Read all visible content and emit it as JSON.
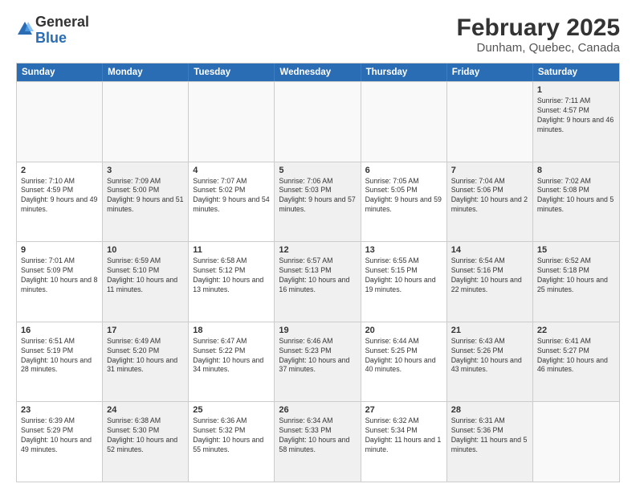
{
  "logo": {
    "general": "General",
    "blue": "Blue"
  },
  "title": "February 2025",
  "subtitle": "Dunham, Quebec, Canada",
  "headers": [
    "Sunday",
    "Monday",
    "Tuesday",
    "Wednesday",
    "Thursday",
    "Friday",
    "Saturday"
  ],
  "rows": [
    [
      {
        "day": "",
        "info": "",
        "empty": true
      },
      {
        "day": "",
        "info": "",
        "empty": true
      },
      {
        "day": "",
        "info": "",
        "empty": true
      },
      {
        "day": "",
        "info": "",
        "empty": true
      },
      {
        "day": "",
        "info": "",
        "empty": true
      },
      {
        "day": "",
        "info": "",
        "empty": true
      },
      {
        "day": "1",
        "info": "Sunrise: 7:11 AM\nSunset: 4:57 PM\nDaylight: 9 hours and 46 minutes.",
        "shaded": true
      }
    ],
    [
      {
        "day": "2",
        "info": "Sunrise: 7:10 AM\nSunset: 4:59 PM\nDaylight: 9 hours and 49 minutes."
      },
      {
        "day": "3",
        "info": "Sunrise: 7:09 AM\nSunset: 5:00 PM\nDaylight: 9 hours and 51 minutes.",
        "shaded": true
      },
      {
        "day": "4",
        "info": "Sunrise: 7:07 AM\nSunset: 5:02 PM\nDaylight: 9 hours and 54 minutes."
      },
      {
        "day": "5",
        "info": "Sunrise: 7:06 AM\nSunset: 5:03 PM\nDaylight: 9 hours and 57 minutes.",
        "shaded": true
      },
      {
        "day": "6",
        "info": "Sunrise: 7:05 AM\nSunset: 5:05 PM\nDaylight: 9 hours and 59 minutes."
      },
      {
        "day": "7",
        "info": "Sunrise: 7:04 AM\nSunset: 5:06 PM\nDaylight: 10 hours and 2 minutes.",
        "shaded": true
      },
      {
        "day": "8",
        "info": "Sunrise: 7:02 AM\nSunset: 5:08 PM\nDaylight: 10 hours and 5 minutes.",
        "shaded": true
      }
    ],
    [
      {
        "day": "9",
        "info": "Sunrise: 7:01 AM\nSunset: 5:09 PM\nDaylight: 10 hours and 8 minutes."
      },
      {
        "day": "10",
        "info": "Sunrise: 6:59 AM\nSunset: 5:10 PM\nDaylight: 10 hours and 11 minutes.",
        "shaded": true
      },
      {
        "day": "11",
        "info": "Sunrise: 6:58 AM\nSunset: 5:12 PM\nDaylight: 10 hours and 13 minutes."
      },
      {
        "day": "12",
        "info": "Sunrise: 6:57 AM\nSunset: 5:13 PM\nDaylight: 10 hours and 16 minutes.",
        "shaded": true
      },
      {
        "day": "13",
        "info": "Sunrise: 6:55 AM\nSunset: 5:15 PM\nDaylight: 10 hours and 19 minutes."
      },
      {
        "day": "14",
        "info": "Sunrise: 6:54 AM\nSunset: 5:16 PM\nDaylight: 10 hours and 22 minutes.",
        "shaded": true
      },
      {
        "day": "15",
        "info": "Sunrise: 6:52 AM\nSunset: 5:18 PM\nDaylight: 10 hours and 25 minutes.",
        "shaded": true
      }
    ],
    [
      {
        "day": "16",
        "info": "Sunrise: 6:51 AM\nSunset: 5:19 PM\nDaylight: 10 hours and 28 minutes."
      },
      {
        "day": "17",
        "info": "Sunrise: 6:49 AM\nSunset: 5:20 PM\nDaylight: 10 hours and 31 minutes.",
        "shaded": true
      },
      {
        "day": "18",
        "info": "Sunrise: 6:47 AM\nSunset: 5:22 PM\nDaylight: 10 hours and 34 minutes."
      },
      {
        "day": "19",
        "info": "Sunrise: 6:46 AM\nSunset: 5:23 PM\nDaylight: 10 hours and 37 minutes.",
        "shaded": true
      },
      {
        "day": "20",
        "info": "Sunrise: 6:44 AM\nSunset: 5:25 PM\nDaylight: 10 hours and 40 minutes."
      },
      {
        "day": "21",
        "info": "Sunrise: 6:43 AM\nSunset: 5:26 PM\nDaylight: 10 hours and 43 minutes.",
        "shaded": true
      },
      {
        "day": "22",
        "info": "Sunrise: 6:41 AM\nSunset: 5:27 PM\nDaylight: 10 hours and 46 minutes.",
        "shaded": true
      }
    ],
    [
      {
        "day": "23",
        "info": "Sunrise: 6:39 AM\nSunset: 5:29 PM\nDaylight: 10 hours and 49 minutes."
      },
      {
        "day": "24",
        "info": "Sunrise: 6:38 AM\nSunset: 5:30 PM\nDaylight: 10 hours and 52 minutes.",
        "shaded": true
      },
      {
        "day": "25",
        "info": "Sunrise: 6:36 AM\nSunset: 5:32 PM\nDaylight: 10 hours and 55 minutes."
      },
      {
        "day": "26",
        "info": "Sunrise: 6:34 AM\nSunset: 5:33 PM\nDaylight: 10 hours and 58 minutes.",
        "shaded": true
      },
      {
        "day": "27",
        "info": "Sunrise: 6:32 AM\nSunset: 5:34 PM\nDaylight: 11 hours and 1 minute."
      },
      {
        "day": "28",
        "info": "Sunrise: 6:31 AM\nSunset: 5:36 PM\nDaylight: 11 hours and 5 minutes.",
        "shaded": true
      },
      {
        "day": "",
        "info": "",
        "empty": true
      }
    ]
  ]
}
